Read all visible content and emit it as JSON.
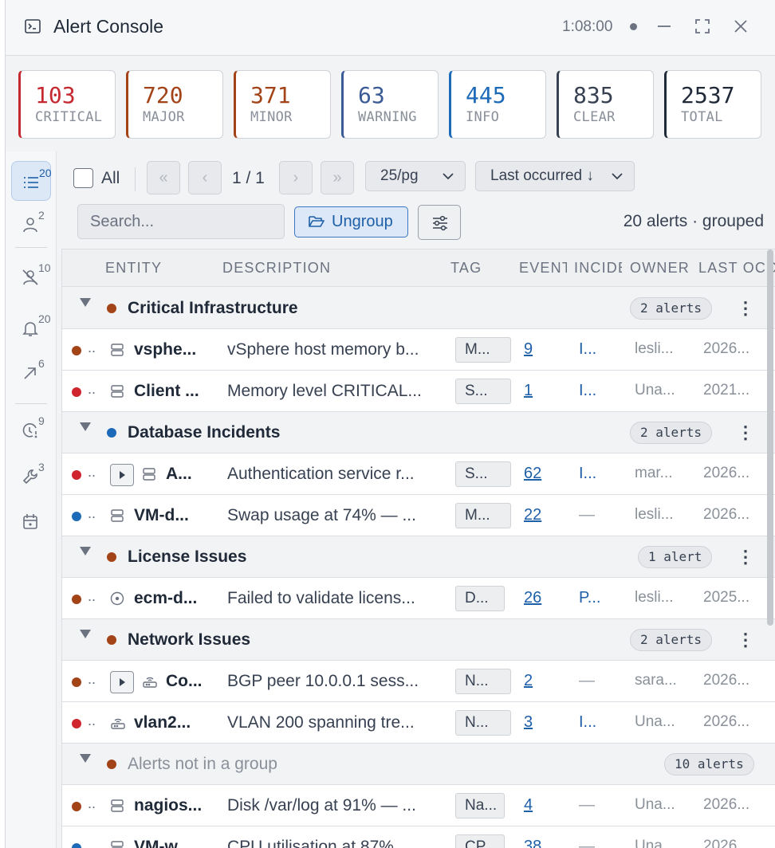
{
  "window": {
    "title": "Alert Console",
    "clock": "1:08:00",
    "icons": {
      "app": "terminal-icon",
      "minimize": "minimize-icon",
      "maximize": "maximize-icon",
      "close": "close-icon"
    }
  },
  "summary": [
    {
      "value": "103",
      "label": "CRITICAL",
      "color": "#c62830"
    },
    {
      "value": "720",
      "label": "MAJOR",
      "color": "#a24318"
    },
    {
      "value": "371",
      "label": "MINOR",
      "color": "#a24318"
    },
    {
      "value": "63",
      "label": "WARNING",
      "color": "#3b5b96"
    },
    {
      "value": "445",
      "label": "INFO",
      "color": "#1d6ab8"
    },
    {
      "value": "835",
      "label": "CLEAR",
      "color": "#374151"
    },
    {
      "value": "2537",
      "label": "TOTAL",
      "color": "#1f2937"
    }
  ],
  "rail": [
    {
      "icon": "list-icon",
      "badge": "20",
      "active": true
    },
    {
      "icon": "user-icon",
      "badge": "2"
    },
    {
      "icon": "user-off-icon",
      "badge": "10"
    },
    {
      "icon": "bell-icon",
      "badge": "20"
    },
    {
      "icon": "arrow-escalate-icon",
      "badge": "6"
    },
    {
      "icon": "clock-alert-icon",
      "badge": "9"
    },
    {
      "icon": "wrench-icon",
      "badge": "3"
    },
    {
      "icon": "calendar-icon",
      "badge": ""
    }
  ],
  "toolbar": {
    "select_all_label": "All",
    "first_page": "«",
    "prev_page": "‹",
    "page_label": "1 / 1",
    "next_page": "›",
    "last_page": "»",
    "page_size": "25/pg",
    "sort": "Last occurred ↓",
    "search_placeholder": "Search...",
    "ungroup_label": "Ungroup",
    "count_label": "20 alerts · grouped"
  },
  "columns": [
    "ENTITY",
    "DESCRIPTION",
    "TAG",
    "EVENTS",
    "INCIDENT",
    "OWNER",
    "LAST OCCURRED"
  ],
  "groups": [
    {
      "name": "Critical Infrastructure",
      "dot": "#a24318",
      "count": "2 alerts",
      "muted": false,
      "rows": [
        {
          "dot": "#a24318",
          "icon": "server-icon",
          "expand": false,
          "entity": "vsphe...",
          "description": "vSphere host memory b...",
          "tag": "M...",
          "events": "9",
          "incident": "I...",
          "owner": "lesli...",
          "last": "2026..."
        },
        {
          "dot": "#d0242e",
          "icon": "server-icon",
          "expand": false,
          "entity": "Client ...",
          "description": "Memory level CRITICAL...",
          "tag": "S...",
          "events": "1",
          "incident": "I...",
          "owner": "Una...",
          "last": "2021..."
        }
      ]
    },
    {
      "name": "Database Incidents",
      "dot": "#1d6ab8",
      "count": "2 alerts",
      "muted": false,
      "rows": [
        {
          "dot": "#d0242e",
          "icon": "server-icon",
          "expand": true,
          "entity": "A...",
          "description": "Authentication service r...",
          "tag": "S...",
          "events": "62",
          "incident": "I...",
          "owner": "mar...",
          "last": "2026..."
        },
        {
          "dot": "#1d6ab8",
          "icon": "server-icon",
          "expand": false,
          "entity": "VM-d...",
          "description": "Swap usage at 74% — ...",
          "tag": "M...",
          "events": "22",
          "incident": "—",
          "owner": "lesli...",
          "last": "2026..."
        }
      ]
    },
    {
      "name": "License Issues",
      "dot": "#a24318",
      "count": "1 alert",
      "muted": false,
      "rows": [
        {
          "dot": "#a24318",
          "icon": "target-icon",
          "expand": false,
          "entity": "ecm-d...",
          "description": "Failed to validate licens...",
          "tag": "D...",
          "events": "26",
          "incident": "P...",
          "owner": "lesli...",
          "last": "2025..."
        }
      ]
    },
    {
      "name": "Network Issues",
      "dot": "#a24318",
      "count": "2 alerts",
      "muted": false,
      "rows": [
        {
          "dot": "#a24318",
          "icon": "router-icon",
          "expand": true,
          "entity": "Co...",
          "description": "BGP peer 10.0.0.1 sess...",
          "tag": "N...",
          "events": "2",
          "incident": "—",
          "owner": "sara...",
          "last": "2026..."
        },
        {
          "dot": "#d0242e",
          "icon": "router-icon",
          "expand": false,
          "entity": "vlan2...",
          "description": "VLAN 200 spanning tre...",
          "tag": "N...",
          "events": "3",
          "incident": "I...",
          "owner": "Una...",
          "last": "2026..."
        }
      ]
    },
    {
      "name": "Alerts not in a group",
      "dot": "#a24318",
      "count": "10 alerts",
      "muted": true,
      "rows": [
        {
          "dot": "#a24318",
          "icon": "server-icon",
          "expand": false,
          "entity": "nagios...",
          "description": "Disk /var/log at 91% — ...",
          "tag": "Na...",
          "events": "4",
          "incident": "—",
          "owner": "Una...",
          "last": "2026..."
        },
        {
          "dot": "#1d6ab8",
          "icon": "server-icon",
          "expand": false,
          "entity": "VM-w...",
          "description": "CPU utilisation at 87%...",
          "tag": "CP...",
          "events": "38",
          "incident": "—",
          "owner": "Una...",
          "last": "2026..."
        }
      ]
    }
  ]
}
